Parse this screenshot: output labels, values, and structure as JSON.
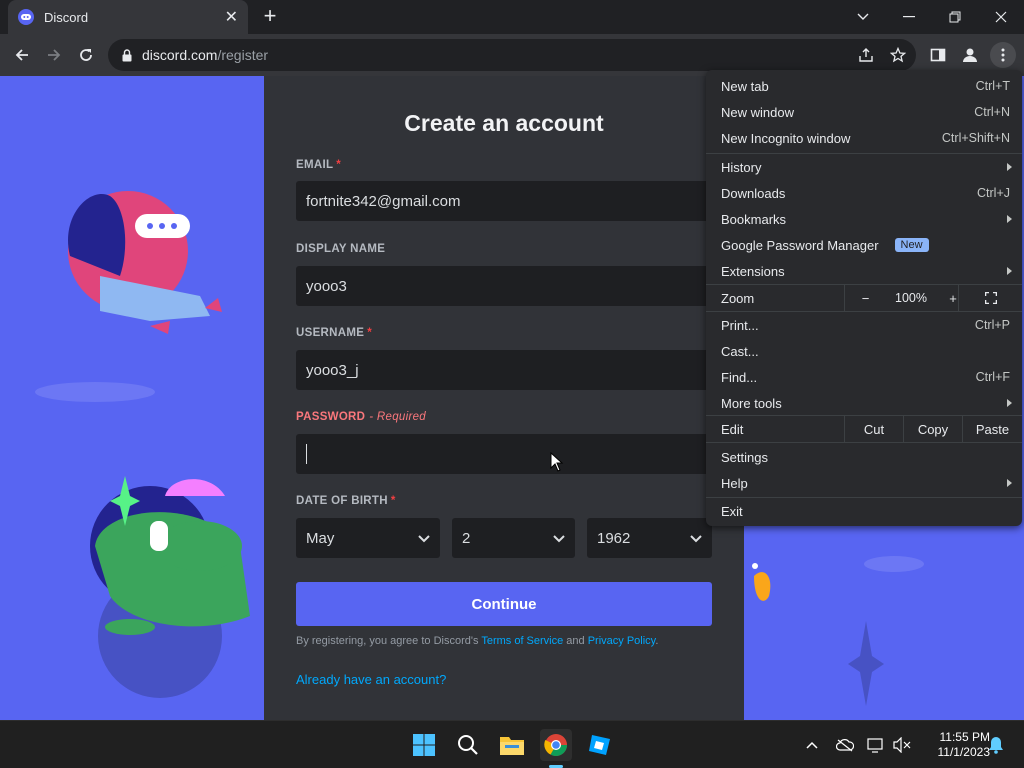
{
  "browser": {
    "tab_title": "Discord",
    "url_host": "discord.com",
    "url_path": "/register"
  },
  "form": {
    "title": "Create an account",
    "email_label": "EMAIL",
    "email_value": "fortnite342@gmail.com",
    "display_name_label": "DISPLAY NAME",
    "display_name_value": "yooo3",
    "username_label": "USERNAME",
    "username_value": "yooo3_j",
    "password_label": "PASSWORD",
    "password_note": "- Required",
    "password_value": "",
    "dob_label": "DATE OF BIRTH",
    "dob_month": "May",
    "dob_day": "2",
    "dob_year": "1962",
    "required_mark": "*",
    "continue_label": "Continue",
    "terms_prefix": "By registering, you agree to Discord's ",
    "terms_link": "Terms of Service",
    "terms_and": " and ",
    "privacy_link": "Privacy Policy",
    "terms_suffix": ".",
    "login_link": "Already have an account?"
  },
  "menu": {
    "new_tab": "New tab",
    "new_tab_sc": "Ctrl+T",
    "new_window": "New window",
    "new_window_sc": "Ctrl+N",
    "new_incognito": "New Incognito window",
    "new_incognito_sc": "Ctrl+Shift+N",
    "history": "History",
    "downloads": "Downloads",
    "downloads_sc": "Ctrl+J",
    "bookmarks": "Bookmarks",
    "password_manager": "Google Password Manager",
    "password_badge": "New",
    "extensions": "Extensions",
    "zoom": "Zoom",
    "zoom_minus": "−",
    "zoom_value": "100%",
    "zoom_plus": "+",
    "print": "Print...",
    "print_sc": "Ctrl+P",
    "cast": "Cast...",
    "find": "Find...",
    "find_sc": "Ctrl+F",
    "more_tools": "More tools",
    "edit": "Edit",
    "cut": "Cut",
    "copy": "Copy",
    "paste": "Paste",
    "settings": "Settings",
    "help": "Help",
    "exit": "Exit"
  },
  "taskbar": {
    "time": "11:55 PM",
    "date": "11/1/2023"
  },
  "colors": {
    "discord_blurple": "#5865f2",
    "card_bg": "#313338",
    "input_bg": "#1e1f22",
    "link": "#00a8fc",
    "error": "#fa777c"
  },
  "icons": {
    "back": "arrow-left-icon",
    "forward": "arrow-right-icon",
    "reload": "reload-icon",
    "lock": "lock-icon",
    "share": "share-icon",
    "star": "star-icon",
    "sidepanel": "side-panel-icon",
    "profile": "profile-icon",
    "menu": "kebab-menu-icon"
  }
}
